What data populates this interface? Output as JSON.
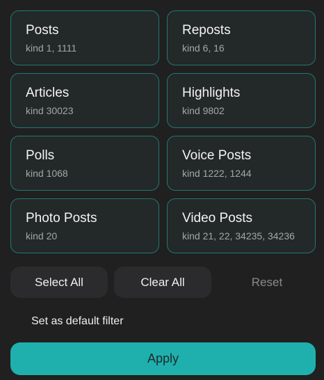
{
  "filters": [
    {
      "title": "Posts",
      "subtitle": "kind 1, 1111"
    },
    {
      "title": "Reposts",
      "subtitle": "kind 6, 16"
    },
    {
      "title": "Articles",
      "subtitle": "kind 30023"
    },
    {
      "title": "Highlights",
      "subtitle": "kind 9802"
    },
    {
      "title": "Polls",
      "subtitle": "kind 1068"
    },
    {
      "title": "Voice Posts",
      "subtitle": "kind 1222, 1244"
    },
    {
      "title": "Photo Posts",
      "subtitle": "kind 20"
    },
    {
      "title": "Video Posts",
      "subtitle": "kind 21, 22, 34235, 34236"
    }
  ],
  "actions": {
    "select_all": "Select All",
    "clear_all": "Clear All",
    "reset": "Reset"
  },
  "default_filter": {
    "label": "Set as default filter",
    "checked": false
  },
  "apply_label": "Apply",
  "colors": {
    "background": "#202020",
    "card_border": "#1f7a72",
    "accent": "#1fb0ad",
    "button_bg": "#2b2b2d"
  }
}
